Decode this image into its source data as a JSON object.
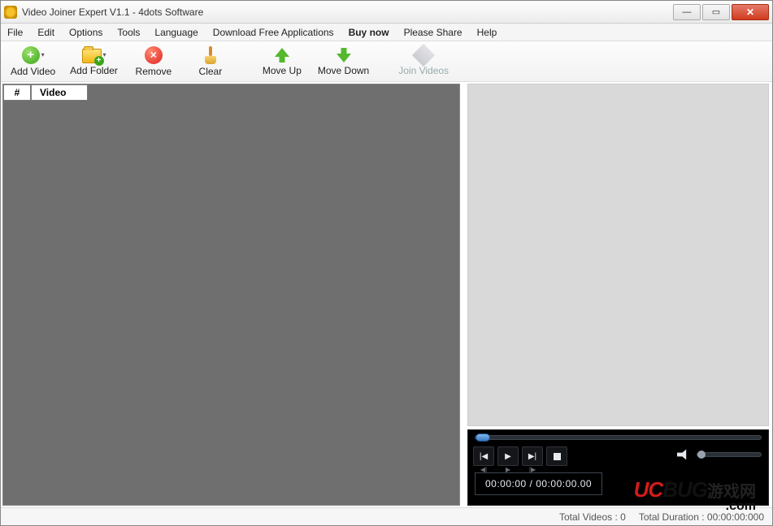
{
  "window": {
    "title": "Video Joiner Expert V1.1 - 4dots Software"
  },
  "menu": {
    "file": "File",
    "edit": "Edit",
    "options": "Options",
    "tools": "Tools",
    "language": "Language",
    "download": "Download Free Applications",
    "buynow": "Buy now",
    "share": "Please Share",
    "help": "Help"
  },
  "toolbar": {
    "add_video": "Add Video",
    "add_folder": "Add Folder",
    "remove": "Remove",
    "clear": "Clear",
    "move_up": "Move Up",
    "move_down": "Move Down",
    "join_videos": "Join Videos"
  },
  "grid": {
    "col_num": "#",
    "col_video": "Video"
  },
  "player": {
    "time_display": "00:00:00 / 00:00:00.00"
  },
  "status": {
    "total_videos_label": "Total Videos :",
    "total_videos_value": "0",
    "total_duration_label": "Total Duration :",
    "total_duration_value": "00:00:00:000"
  },
  "watermark": {
    "uc": "UC",
    "bug": "BUG",
    "cn": "游戏网",
    "com": ".com"
  }
}
